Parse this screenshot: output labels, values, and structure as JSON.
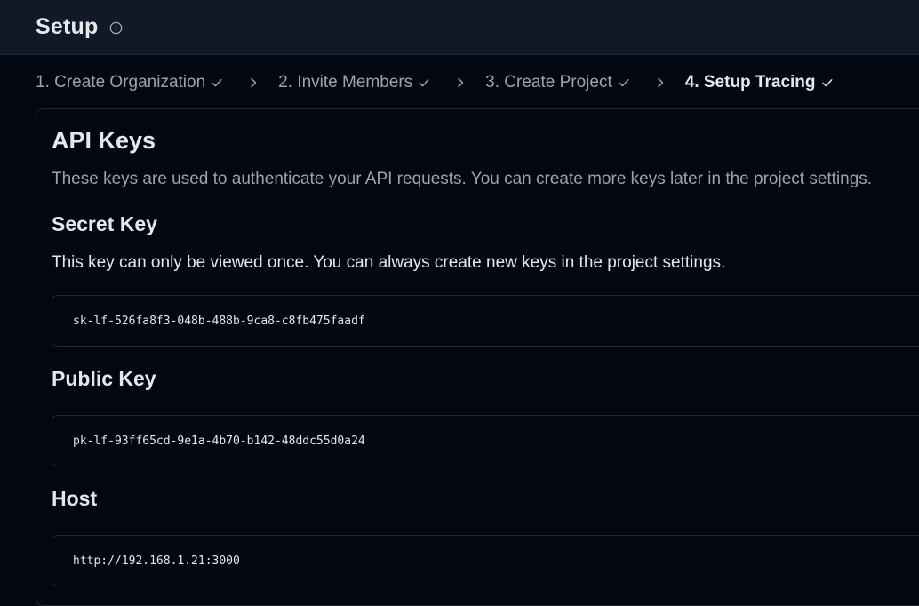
{
  "header": {
    "title": "Setup",
    "info_icon": "info-icon"
  },
  "stepper": {
    "steps": [
      {
        "label": "1. Create Organization",
        "completed": true
      },
      {
        "label": "2. Invite Members",
        "completed": true
      },
      {
        "label": "3. Create Project",
        "completed": true
      },
      {
        "label": "4. Setup Tracing",
        "completed": true,
        "current": true
      }
    ]
  },
  "api_keys": {
    "title": "API Keys",
    "description": "These keys are used to authenticate your API requests. You can create more keys later in the project settings.",
    "secret": {
      "title": "Secret Key",
      "note": "This key can only be viewed once. You can always create new keys in the project settings.",
      "value": "sk-lf-526fa8f3-048b-488b-9ca8-c8fb475faadf"
    },
    "public": {
      "title": "Public Key",
      "value": "pk-lf-93ff65cd-9e1a-4b70-b142-48ddc55d0a24"
    },
    "host": {
      "title": "Host",
      "value": "http://192.168.1.21:3000"
    }
  },
  "colors": {
    "background": "#030712",
    "header_background": "#111827",
    "border": "#1f2937",
    "text_primary": "#e5e7eb",
    "text_muted": "#9ca3af"
  }
}
